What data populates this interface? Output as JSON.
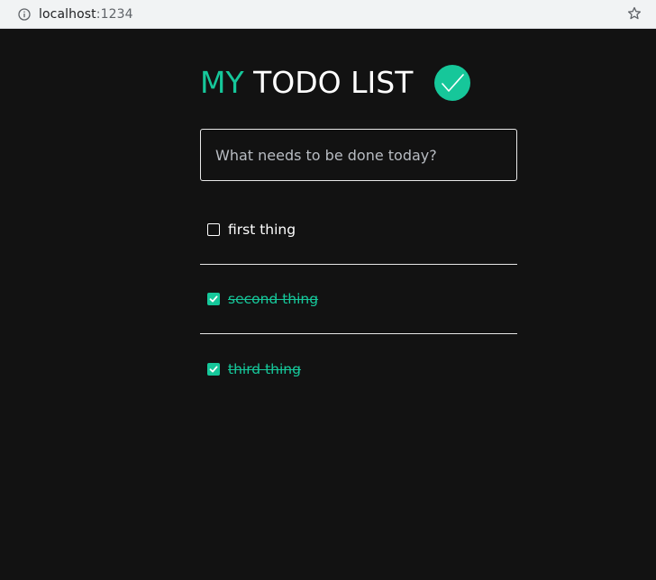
{
  "browser": {
    "host": "localhost",
    "port": ":1234"
  },
  "header": {
    "title_accent": "MY",
    "title_rest": " TODO LIST",
    "badge_icon": "checkmark-icon"
  },
  "new_todo": {
    "placeholder": "What needs to be done today?",
    "value": ""
  },
  "todos": [
    {
      "label": "first thing",
      "done": false
    },
    {
      "label": "second thing",
      "done": true
    },
    {
      "label": "third thing",
      "done": true
    }
  ],
  "colors": {
    "accent": "#16c79a",
    "background": "#121212",
    "text": "#ffffff"
  }
}
